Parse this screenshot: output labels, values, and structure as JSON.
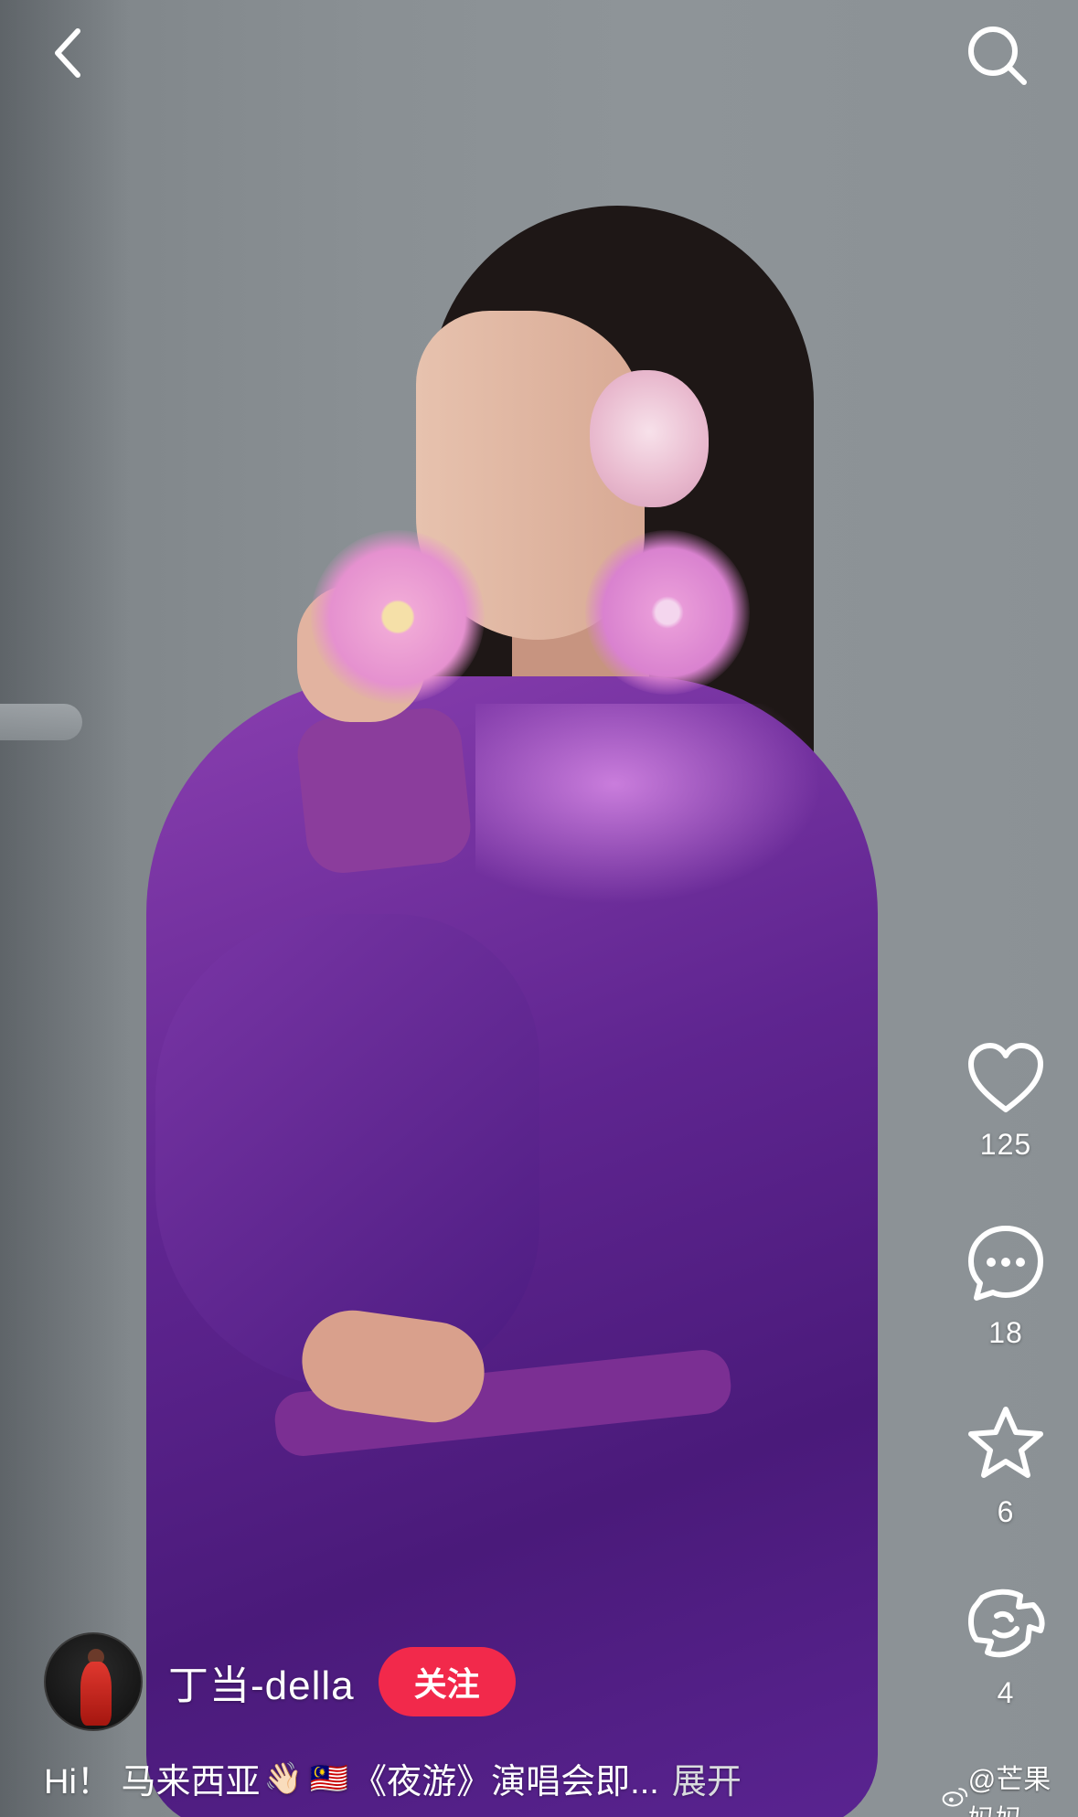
{
  "top_bar": {
    "back_icon": "chevron-left-icon",
    "search_icon": "search-icon"
  },
  "actions": {
    "like": {
      "icon": "heart-icon",
      "count": "125"
    },
    "comment": {
      "icon": "comment-icon",
      "count": "18"
    },
    "favorite": {
      "icon": "star-icon",
      "count": "6"
    },
    "share": {
      "icon": "share-icon",
      "count": "4"
    }
  },
  "author": {
    "name": "丁当-della",
    "follow_label": "关注"
  },
  "caption": {
    "text_start": "Hi！ 马来西亚",
    "emoji_wave": "👋🏻",
    "emoji_flag": "🇲🇾",
    "text_end": " 《夜游》演唱会即...",
    "expand_label": "展开"
  },
  "watermark": {
    "text": "@芒果妈妈"
  },
  "colors": {
    "follow_button": "#f2294b",
    "robe_purple": "#5f2590",
    "background_gray": "#8a9094"
  }
}
